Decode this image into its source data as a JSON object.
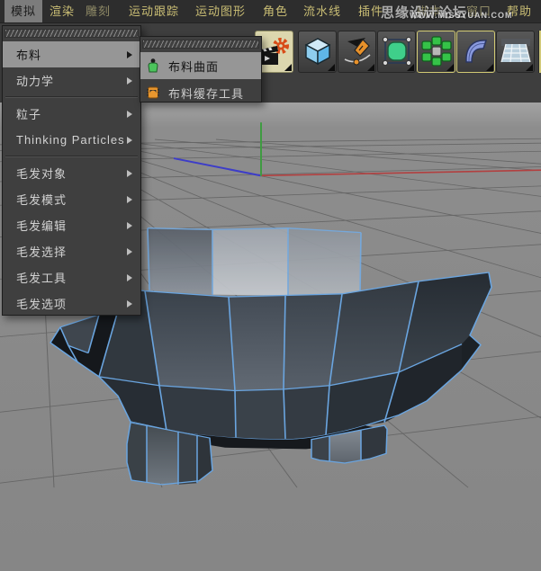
{
  "menu_bar": {
    "items": [
      {
        "label": "模拟",
        "active": true
      },
      {
        "label": "渲染"
      },
      {
        "label": "雕刻"
      },
      {
        "label": "运动跟踪"
      },
      {
        "label": "运动图形"
      },
      {
        "label": "角色"
      },
      {
        "label": "流水线"
      },
      {
        "label": "插件"
      },
      {
        "label": "脚本"
      },
      {
        "label": "窗口"
      },
      {
        "label": "帮助"
      }
    ]
  },
  "watermark": {
    "line1": "思缘设计论坛",
    "line2": "WWW.MISSYUAN.COM"
  },
  "toolbar": {
    "icons": [
      {
        "name": "render-settings-icon",
        "active": true
      },
      {
        "name": "cube-primitive-icon",
        "active": false
      },
      {
        "name": "pen-spline-icon",
        "active": false
      },
      {
        "name": "subdivision-surface-icon",
        "active": false
      },
      {
        "name": "cloner-mograph-icon",
        "active": true
      },
      {
        "name": "bend-deformer-icon",
        "active": true
      },
      {
        "name": "floor-environment-icon",
        "active": false
      }
    ]
  },
  "simulate_menu": {
    "items": [
      {
        "label": "布料",
        "highlighted": true,
        "has_submenu": true
      },
      {
        "label": "动力学",
        "has_submenu": true
      },
      {
        "label": "粒子",
        "has_submenu": true
      },
      {
        "label": "Thinking Particles",
        "has_submenu": true
      },
      {
        "label": "毛发对象",
        "has_submenu": true
      },
      {
        "label": "毛发模式",
        "has_submenu": true
      },
      {
        "label": "毛发编辑",
        "has_submenu": true
      },
      {
        "label": "毛发选择",
        "has_submenu": true
      },
      {
        "label": "毛发工具",
        "has_submenu": true
      },
      {
        "label": "毛发选项",
        "has_submenu": true
      }
    ]
  },
  "cloth_submenu": {
    "items": [
      {
        "label": "布料曲面",
        "icon": "cloth-surface-icon",
        "highlighted": true
      },
      {
        "label": "布料缓存工具",
        "icon": "cloth-cache-tool-icon",
        "highlighted": false
      }
    ]
  },
  "viewport": {
    "background": "#8b8b8b",
    "grid_line_color": "#666666",
    "selection_edge_color": "#6aa5e0",
    "axis_colors": {
      "x": "#b24040",
      "y": "#3f9b41",
      "z": "#3d3dc8"
    }
  }
}
